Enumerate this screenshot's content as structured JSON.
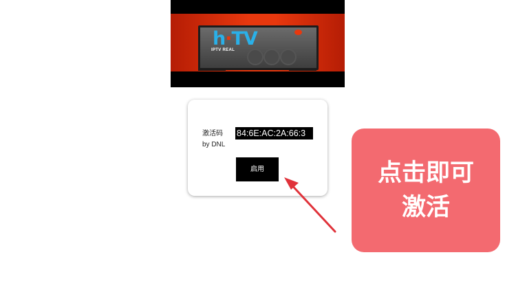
{
  "banner": {
    "logo_h": "h",
    "logo_dot": "·",
    "logo_tv": "TV",
    "subtitle": "IPTV REAL"
  },
  "dialog": {
    "activation_label": "激活码",
    "by_label": "by DNL",
    "code_value": "84:6E:AC:2A:66:3",
    "enable_button": "启用"
  },
  "callout": {
    "line1": "点击即可",
    "line2": "激活",
    "color": "#f36a70"
  },
  "arrow": {
    "color": "#e0323a"
  }
}
